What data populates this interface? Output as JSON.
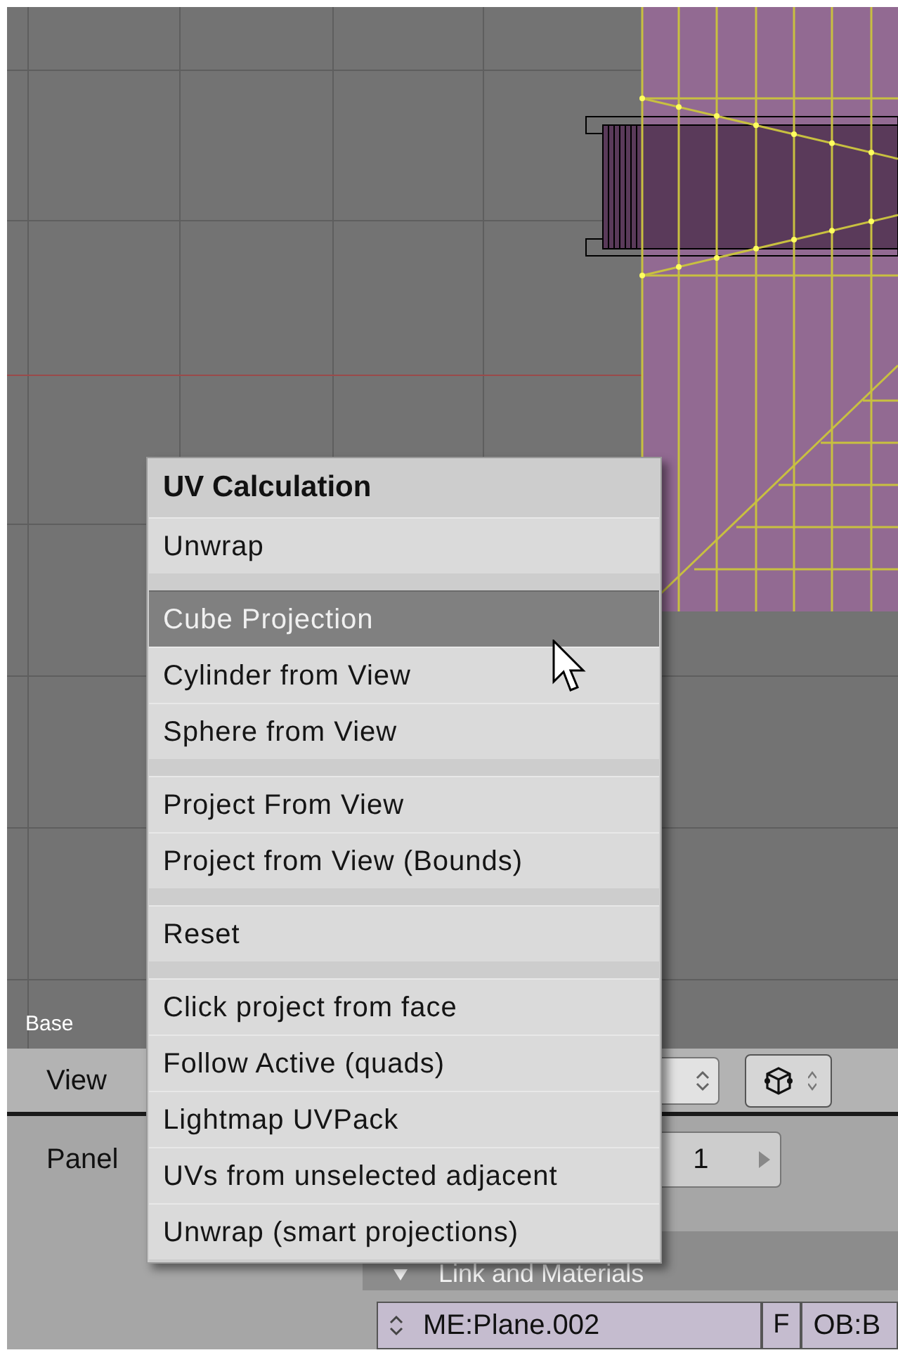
{
  "viewport": {
    "object_label": "Base"
  },
  "header": {
    "menu_label": "View"
  },
  "buttons_window": {
    "panels_label": "Panel",
    "layer_value": "1",
    "panel_title": "Link and Materials",
    "mesh_field": "ME:Plane.002",
    "fake_user": "F",
    "object_field": "OB:B"
  },
  "menu": {
    "title": "UV Calculation",
    "groups": [
      [
        {
          "label": "Unwrap",
          "selected": false
        }
      ],
      [
        {
          "label": "Cube Projection",
          "selected": true
        },
        {
          "label": "Cylinder from View",
          "selected": false
        },
        {
          "label": "Sphere from View",
          "selected": false
        }
      ],
      [
        {
          "label": "Project From View",
          "selected": false
        },
        {
          "label": "Project from View (Bounds)",
          "selected": false
        }
      ],
      [
        {
          "label": "Reset",
          "selected": false
        }
      ],
      [
        {
          "label": "Click project from face",
          "selected": false
        },
        {
          "label": "Follow Active (quads)",
          "selected": false
        },
        {
          "label": "Lightmap UVPack",
          "selected": false
        },
        {
          "label": "UVs from unselected adjacent",
          "selected": false
        },
        {
          "label": "Unwrap (smart projections)",
          "selected": false
        }
      ]
    ]
  }
}
